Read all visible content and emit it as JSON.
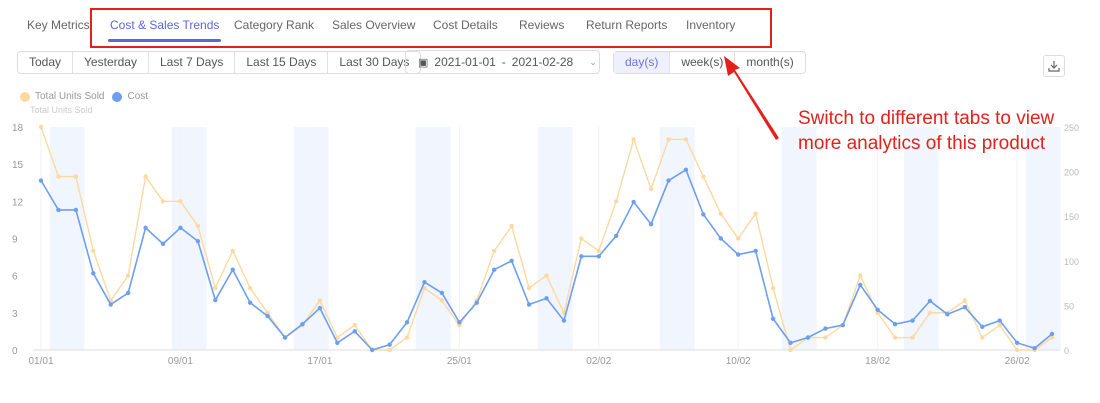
{
  "tabs": [
    {
      "label": "Key Metrics"
    },
    {
      "label": "Cost & Sales Trends",
      "active": true
    },
    {
      "label": "Category Rank"
    },
    {
      "label": "Sales Overview"
    },
    {
      "label": "Cost Details"
    },
    {
      "label": "Reviews"
    },
    {
      "label": "Return Reports"
    },
    {
      "label": "Inventory"
    }
  ],
  "quick_ranges": [
    "Today",
    "Yesterday",
    "Last 7 Days",
    "Last 15 Days",
    "Last 30 Days"
  ],
  "date_range": {
    "start": "2021-01-01",
    "separator": "-",
    "end": "2021-02-28"
  },
  "granularity": {
    "options": [
      "day(s)",
      "week(s)",
      "month(s)"
    ],
    "selected": "day(s)"
  },
  "annotation": {
    "line1": "Switch to different tabs to view",
    "line2": "more analytics of this product",
    "color": "#e3211c"
  },
  "chart_data": {
    "type": "line",
    "legend": [
      {
        "name": "Total Units Sold",
        "color": "#fcd9a1"
      },
      {
        "name": "Cost",
        "color": "#6d9ef0"
      }
    ],
    "ylabel": "Total Units Sold",
    "x_ticks": [
      "01/01",
      "09/01",
      "17/01",
      "25/01",
      "02/02",
      "10/02",
      "18/02",
      "26/02"
    ],
    "x_start": "2021-01-01",
    "x_end": "2021-02-28",
    "y_left": {
      "ticks": [
        0,
        3,
        6,
        9,
        12,
        15,
        18
      ],
      "range": [
        0,
        18
      ]
    },
    "y_right": {
      "ticks": [
        0,
        50,
        100,
        150,
        200,
        250
      ],
      "range": [
        0,
        250
      ]
    },
    "weekend_shading": true,
    "series": [
      {
        "name": "Total Units Sold",
        "axis": "left",
        "color": "#fcd9a1",
        "values": [
          18,
          14,
          14,
          8,
          4,
          6,
          14,
          12,
          12,
          10,
          5,
          8,
          5,
          3,
          1,
          2,
          4,
          1,
          2,
          0,
          0,
          1,
          5,
          4,
          2,
          4,
          8,
          10,
          5,
          6,
          3,
          9,
          8,
          12,
          17,
          13,
          17,
          17,
          14,
          11,
          9,
          11,
          5,
          0,
          1,
          1,
          2,
          6,
          3,
          1,
          1,
          3,
          3,
          4,
          1,
          2,
          0,
          0,
          1
        ]
      },
      {
        "name": "Cost",
        "axis": "right",
        "color": "#6d9ef0",
        "values": [
          190,
          157,
          157,
          86,
          51,
          64,
          137,
          119,
          137,
          122,
          56,
          90,
          53,
          38,
          14,
          29,
          47,
          8,
          21,
          0,
          6,
          31,
          76,
          64,
          31,
          53,
          90,
          100,
          51,
          58,
          33,
          105,
          105,
          128,
          166,
          141,
          190,
          202,
          152,
          125,
          107,
          111,
          35,
          8,
          14,
          24,
          28,
          73,
          45,
          29,
          33,
          55,
          40,
          48,
          26,
          33,
          8,
          2,
          18
        ]
      }
    ]
  }
}
